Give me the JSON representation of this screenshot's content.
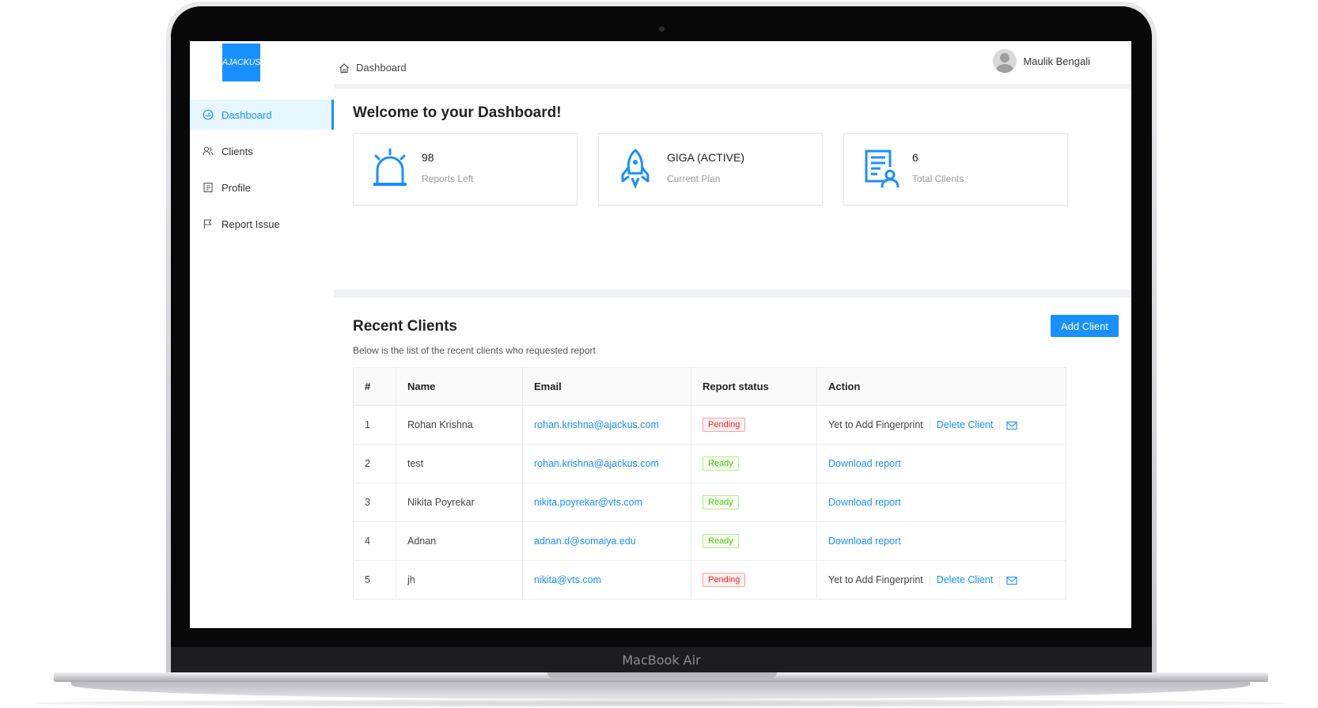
{
  "device": {
    "label": "MacBook Air"
  },
  "app": {
    "logo_text": "AJACKUS"
  },
  "sidebar": {
    "items": [
      {
        "label": "Dashboard",
        "icon": "dashboard-icon",
        "active": true
      },
      {
        "label": "Clients",
        "icon": "clients-icon",
        "active": false
      },
      {
        "label": "Profile",
        "icon": "profile-icon",
        "active": false
      },
      {
        "label": "Report Issue",
        "icon": "flag-icon",
        "active": false
      }
    ]
  },
  "header": {
    "breadcrumb": "Dashboard",
    "user_name": "Maulik Bengali"
  },
  "welcome": {
    "title": "Welcome to your Dashboard!",
    "cards": [
      {
        "value": "98",
        "label": "Reports Left",
        "icon": "alarm-icon"
      },
      {
        "value": "GIGA (ACTIVE)",
        "label": "Current Plan",
        "icon": "rocket-icon"
      },
      {
        "value": "6",
        "label": "Total Clients",
        "icon": "client-document-icon"
      }
    ]
  },
  "clients": {
    "title": "Recent Clients",
    "subtitle": "Below is the list of the recent clients who requested report",
    "add_button": "Add Client",
    "columns": [
      "#",
      "Name",
      "Email",
      "Report status",
      "Action"
    ],
    "rows": [
      {
        "num": "1",
        "name": "Rohan Krishna",
        "email": "rohan.krishna@ajackus.com",
        "status": "Pending",
        "action_text": "Yet to Add Fingerprint",
        "delete_label": "Delete Client"
      },
      {
        "num": "2",
        "name": "test",
        "email": "rohan.krishna@ajackus.com",
        "status": "Ready",
        "download_label": "Download report"
      },
      {
        "num": "3",
        "name": "Nikita Poyrekar",
        "email": "nikita.poyrekar@vts.com",
        "status": "Ready",
        "download_label": "Download report"
      },
      {
        "num": "4",
        "name": "Adnan",
        "email": "adnan.d@somaiya.edu",
        "status": "Ready",
        "download_label": "Download report"
      },
      {
        "num": "5",
        "name": "jh",
        "email": "nikita@vts.com",
        "status": "Pending",
        "action_text": "Yet to Add Fingerprint",
        "delete_label": "Delete Client"
      }
    ]
  },
  "colors": {
    "primary": "#1890ff",
    "pending": "#f5222d",
    "ready": "#52c41a"
  }
}
